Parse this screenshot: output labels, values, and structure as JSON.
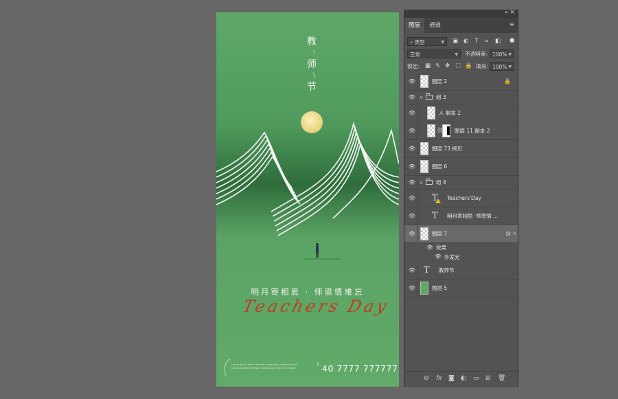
{
  "poster": {
    "title_chars": [
      "教",
      "师",
      "节"
    ],
    "title_sep": "/",
    "slogan": "明月寄相思 · 师恩情难忘",
    "script": "Teachers Day",
    "small_lines": [
      "Lorem ipsum dolor sit amet consectetur adipiscing elit",
      "sed do eiusmod tempor incididunt ut labore et dolore"
    ],
    "phone_mark": "1",
    "phone": "40 7777 777777",
    "colors": {
      "background": "#5fa868",
      "moon": "#f4e6a0",
      "script": "#c7351f"
    }
  },
  "panel": {
    "tabs": [
      "图层",
      "通道"
    ],
    "filter_label": "类型",
    "blend_mode": "正常",
    "opacity_label": "不透明度:",
    "opacity_value": "100%",
    "lock_label": "锁定:",
    "fill_label": "填充:",
    "fill_value": "100%",
    "layers": {
      "l1": "图层 2",
      "g3": "组 3",
      "l2": "人 副本 2",
      "l3": "图层 11 副本 2",
      "l4": "图层 73 拷贝",
      "l5": "图层 6",
      "g4": "组 4",
      "l6": "Teachers'Day",
      "l7": "明月寄相思 ·师恩情 ...",
      "l8": "图层 7",
      "l8_fx": "fx",
      "effects": "效果",
      "outer_glow": "外发光",
      "l9": "教师节",
      "l10": "图层 5"
    }
  }
}
